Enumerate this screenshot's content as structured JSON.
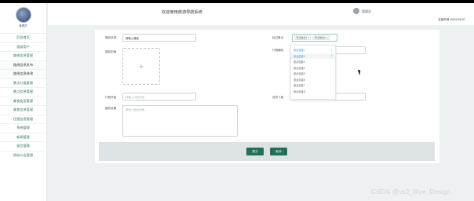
{
  "sidebar": {
    "avatar_name": "管理员",
    "items": [
      {
        "label": "后台首页"
      },
      {
        "label": "旅游用户"
      },
      {
        "label": "路线信息管理"
      },
      {
        "label": "路线信息发布"
      },
      {
        "label": "路线信息修改"
      },
      {
        "label": "景点分类管理"
      },
      {
        "label": "景点信息管理"
      },
      {
        "label": "美食类型管理"
      },
      {
        "label": "美食信息管理"
      },
      {
        "label": "住宿信息管理"
      },
      {
        "label": "系统管理"
      },
      {
        "label": "新闻管理"
      },
      {
        "label": "留言管理"
      },
      {
        "label": "网站公告管理"
      }
    ]
  },
  "header": {
    "title": "欢迎使用旅游导航系统",
    "user": "管理员",
    "time_label": "当前时间：",
    "time_value": "2024-05-02"
  },
  "form": {
    "route_name_label": "路线名称",
    "route_name_value": "请输入路线",
    "scenic_label": "经过景点",
    "scenic_tags": [
      "景点信息1",
      "景点信息2"
    ],
    "cover_label": "路线封面",
    "upload_plus": "+",
    "route_code_label": "行程编码",
    "start_time_label": "行程开始",
    "start_time_placeholder": "请输入行程开始",
    "people_label": "成员人数",
    "desc_label": "路线攻略",
    "desc_placeholder": "请输入路线攻略",
    "tag_close": "×"
  },
  "dropdown": {
    "options": [
      {
        "label": "景点信息1",
        "selected": true
      },
      {
        "label": "景点信息2",
        "selected": true
      },
      {
        "label": "景点信息3",
        "selected": false
      },
      {
        "label": "景点信息4",
        "selected": false
      },
      {
        "label": "景点信息5",
        "selected": false
      },
      {
        "label": "景点信息6",
        "selected": false
      },
      {
        "label": "景点信息7",
        "selected": false
      },
      {
        "label": "景点信息8",
        "selected": false
      }
    ],
    "check": "✓"
  },
  "buttons": {
    "submit": "提交",
    "cancel": "取消"
  },
  "watermark": "CSDN @vx2_Biye_Design"
}
